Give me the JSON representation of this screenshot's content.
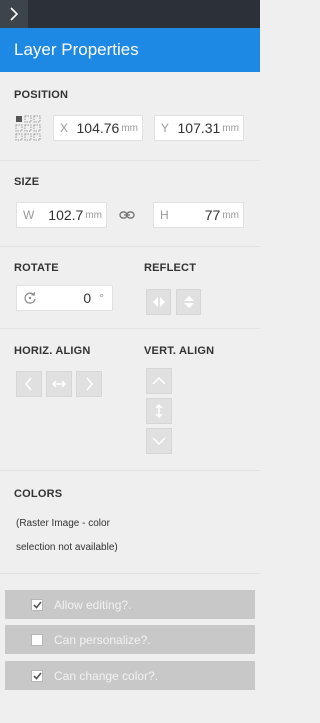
{
  "header": {
    "title": "Layer Properties"
  },
  "position": {
    "title": "POSITION",
    "x": {
      "label": "X",
      "value": "104.76",
      "unit": "mm"
    },
    "y": {
      "label": "Y",
      "value": "107.31",
      "unit": "mm"
    }
  },
  "size": {
    "title": "SIZE",
    "w": {
      "label": "W",
      "value": "102.7",
      "unit": "mm"
    },
    "h": {
      "label": "H",
      "value": "77",
      "unit": "mm"
    }
  },
  "rotate": {
    "title": "ROTATE",
    "value": "0",
    "unit": "°"
  },
  "reflect": {
    "title": "REFLECT"
  },
  "horiz_align": {
    "title": "HORIZ. ALIGN"
  },
  "vert_align": {
    "title": "VERT. ALIGN"
  },
  "colors": {
    "title": "COLORS",
    "note_line1": "(Raster Image - color",
    "note_line2": "selection not available)"
  },
  "options": [
    {
      "label": "Allow editing?.",
      "checked": true
    },
    {
      "label": "Can personalize?.",
      "checked": false
    },
    {
      "label": "Can change color?.",
      "checked": true
    }
  ],
  "colors_palette": {
    "accent": "#1e88e5",
    "topbar": "#2b3137"
  }
}
